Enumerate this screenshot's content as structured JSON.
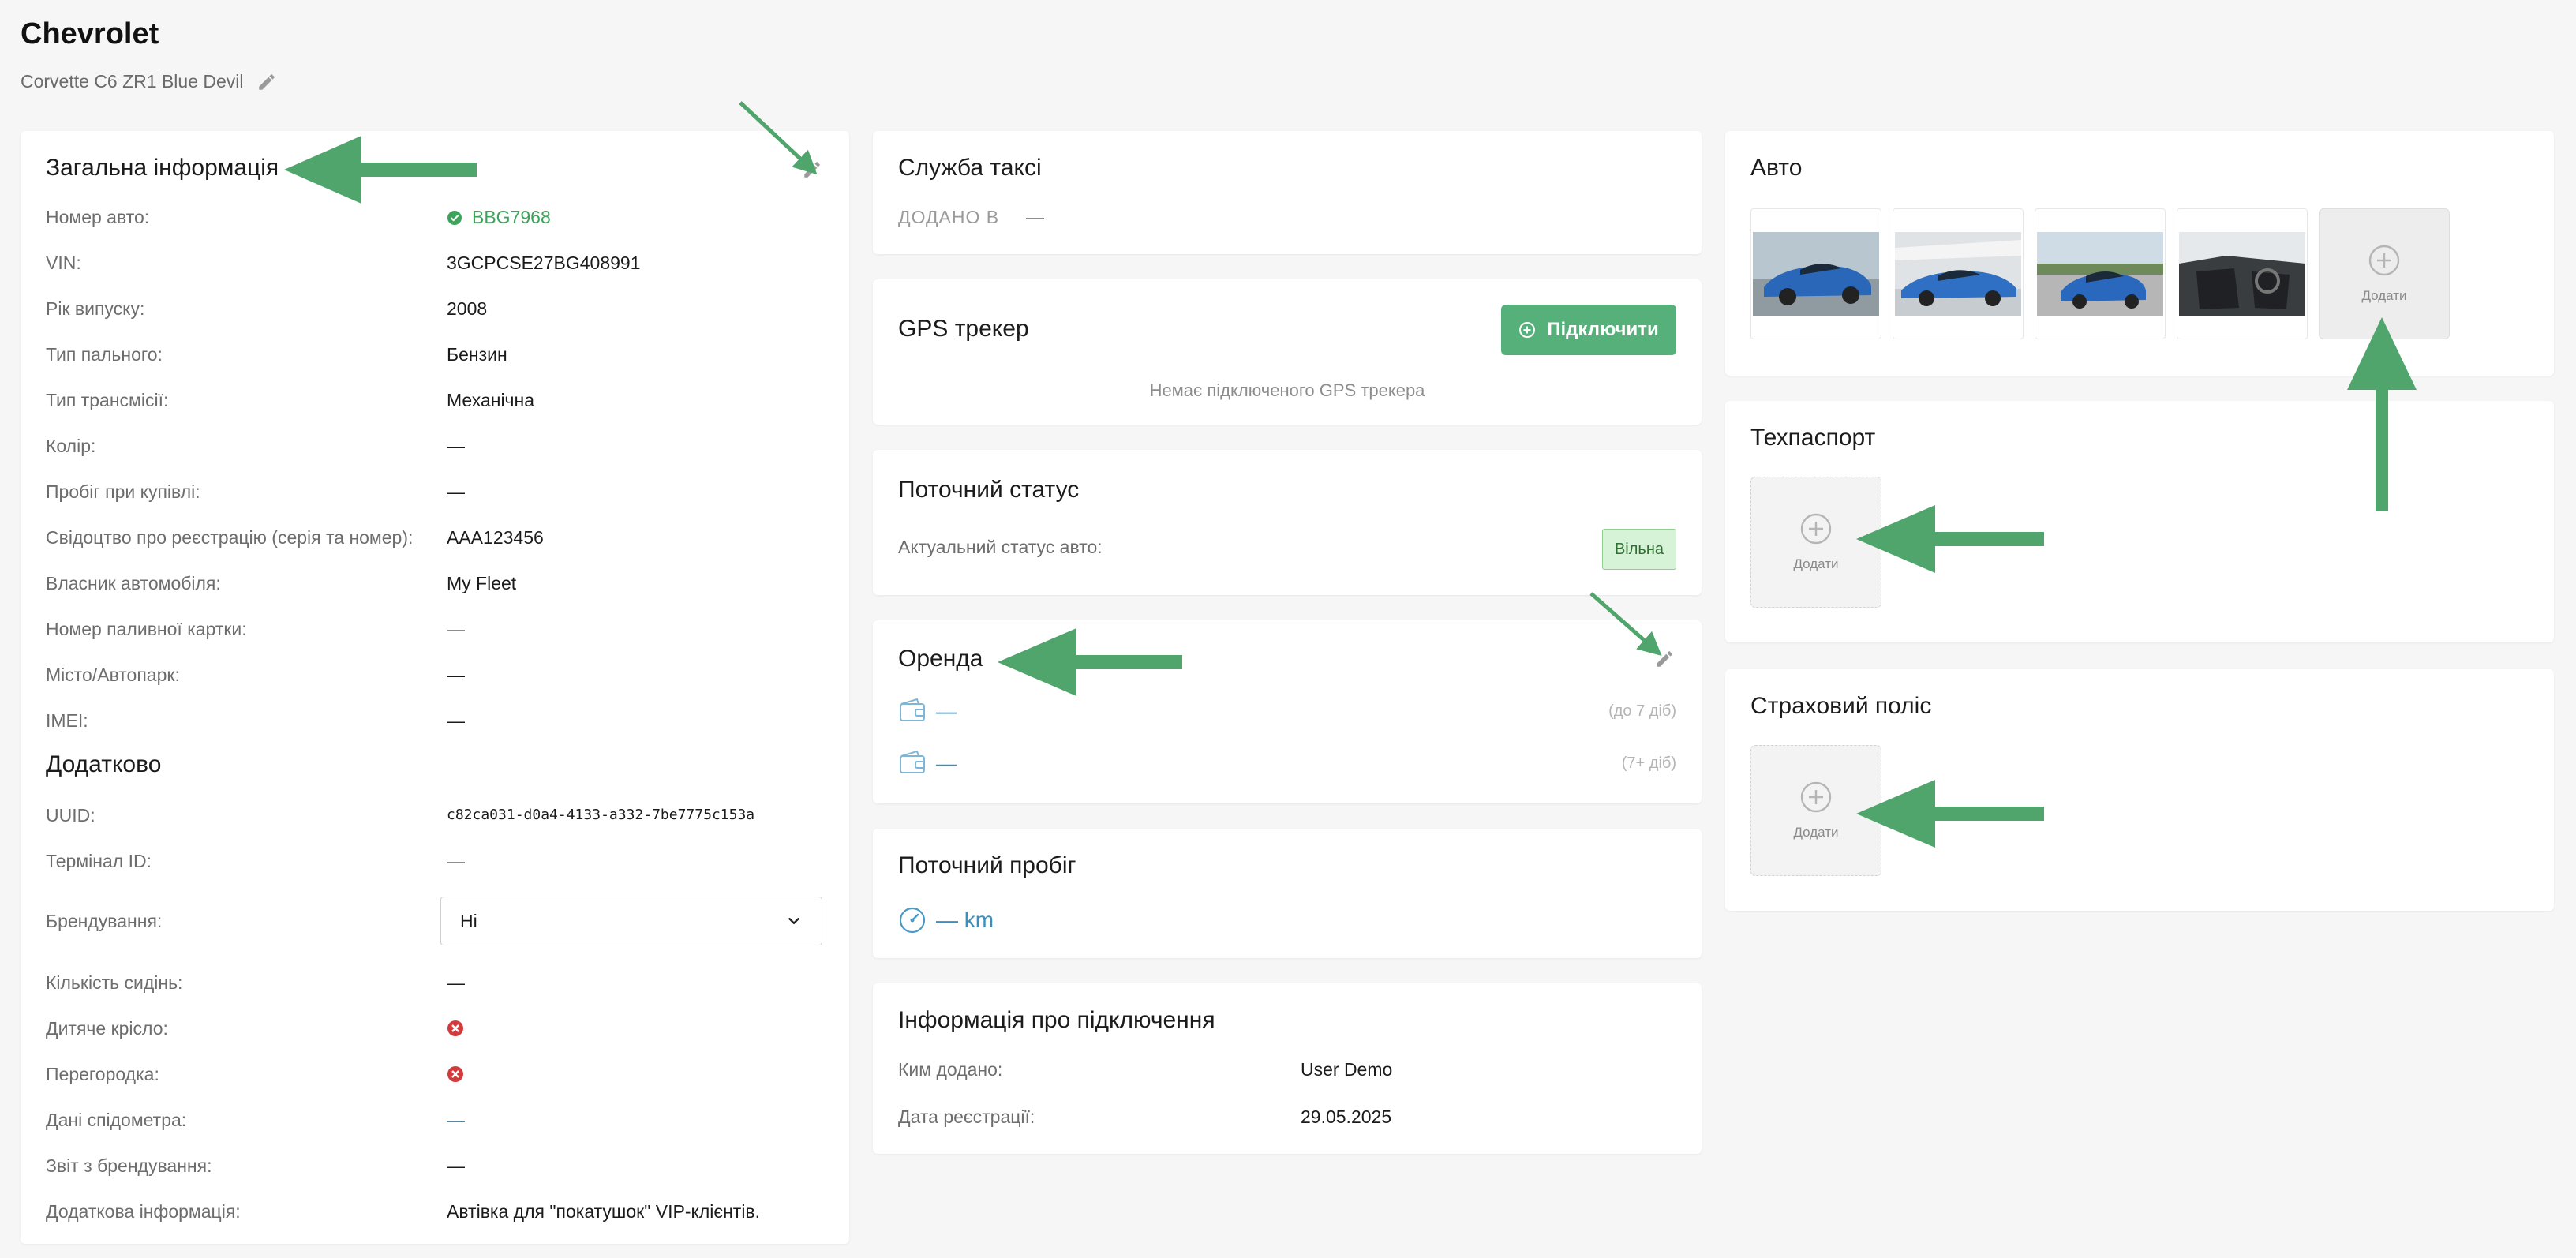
{
  "header": {
    "title": "Chevrolet",
    "subtitle": "Corvette C6 ZR1 Blue Devil"
  },
  "general": {
    "title": "Загальна інформація",
    "rows": [
      {
        "label": "Номер авто:",
        "value": "BBG7968"
      },
      {
        "label": "VIN:",
        "value": "3GCPCSE27BG408991"
      },
      {
        "label": "Рік випуску:",
        "value": "2008"
      },
      {
        "label": "Тип пального:",
        "value": "Бензин"
      },
      {
        "label": "Тип трансмісії:",
        "value": "Механічна"
      },
      {
        "label": "Колір:",
        "value": "—"
      },
      {
        "label": "Пробіг при купівлі:",
        "value": "—"
      },
      {
        "label": "Свідоцтво про реєстрацію (серія та номер):",
        "value": "AAA123456"
      },
      {
        "label": "Власник автомобіля:",
        "value": "My Fleet"
      },
      {
        "label": "Номер паливної картки:",
        "value": "—"
      },
      {
        "label": "Місто/Автопарк:",
        "value": "—"
      },
      {
        "label": "IMEI:",
        "value": "—"
      }
    ]
  },
  "extra": {
    "title": "Додатково",
    "uuid_label": "UUID:",
    "uuid_value": "c82ca031-d0a4-4133-a332-7be7775c153a",
    "terminal_label": "Термінал ID:",
    "terminal_value": "—",
    "branding_label": "Брендування:",
    "branding_selected": "Ні",
    "seats_label": "Кількість сидінь:",
    "seats_value": "—",
    "child_seat_label": "Дитяче крісло:",
    "partition_label": "Перегородка:",
    "speedometer_label": "Дані спідометра:",
    "speedometer_value": "—",
    "branding_report_label": "Звіт з брендування:",
    "branding_report_value": "—",
    "additional_label": "Додаткова інформація:",
    "additional_value": "Автівка для \"покатушок\" VIP-клієнтів."
  },
  "taxi": {
    "title": "Служба таксі",
    "added_label": "ДОДАНО В",
    "added_value": "—"
  },
  "gps": {
    "title": "GPS трекер",
    "button": "Підключити",
    "empty": "Немає підключеного GPS трекера"
  },
  "status": {
    "title": "Поточний статус",
    "label": "Актуальний статус авто:",
    "badge": "Вільна"
  },
  "rent": {
    "title": "Оренда",
    "rows": [
      {
        "value": "—",
        "period": "(до 7 діб)"
      },
      {
        "value": "—",
        "period": "(7+ діб)"
      }
    ]
  },
  "mileage": {
    "title": "Поточний пробіг",
    "value": "— km"
  },
  "connection": {
    "title": "Інформація про підключення",
    "added_by_label": "Ким додано:",
    "added_by_value": "User Demo",
    "reg_date_label": "Дата реєстрації:",
    "reg_date_value": "29.05.2025"
  },
  "auto": {
    "title": "Авто",
    "add_label": "Додати"
  },
  "tech_passport": {
    "title": "Техпаспорт",
    "add_label": "Додати"
  },
  "insurance": {
    "title": "Страховий поліс",
    "add_label": "Додати"
  },
  "colors": {
    "accent_green": "#56b07a",
    "verified_green": "#3ea35a",
    "annotation_arrow": "#4fa56b",
    "error_red": "#d23b3b",
    "link_blue": "#3a8fbf"
  }
}
